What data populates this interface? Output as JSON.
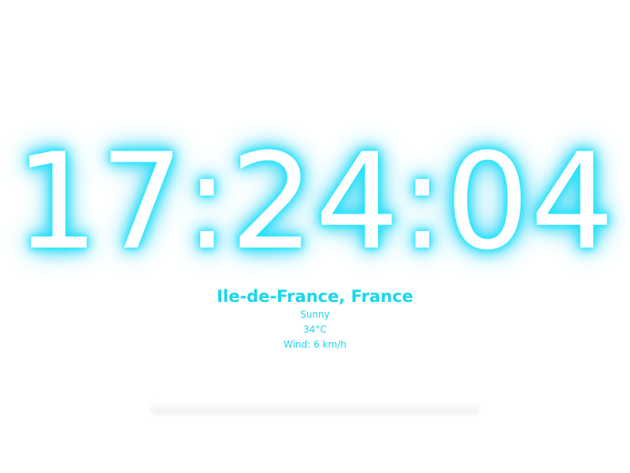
{
  "clock": {
    "time": "17:24:04"
  },
  "weather": {
    "location": "Ile-de-France, France",
    "condition": "Sunny",
    "temperature": "34°C",
    "wind": "Wind: 6 km/h"
  },
  "colors": {
    "background": "#ffffff",
    "accent": "#18d7ea",
    "glow": "#22e6ff",
    "clock_text": "#ffffff"
  }
}
